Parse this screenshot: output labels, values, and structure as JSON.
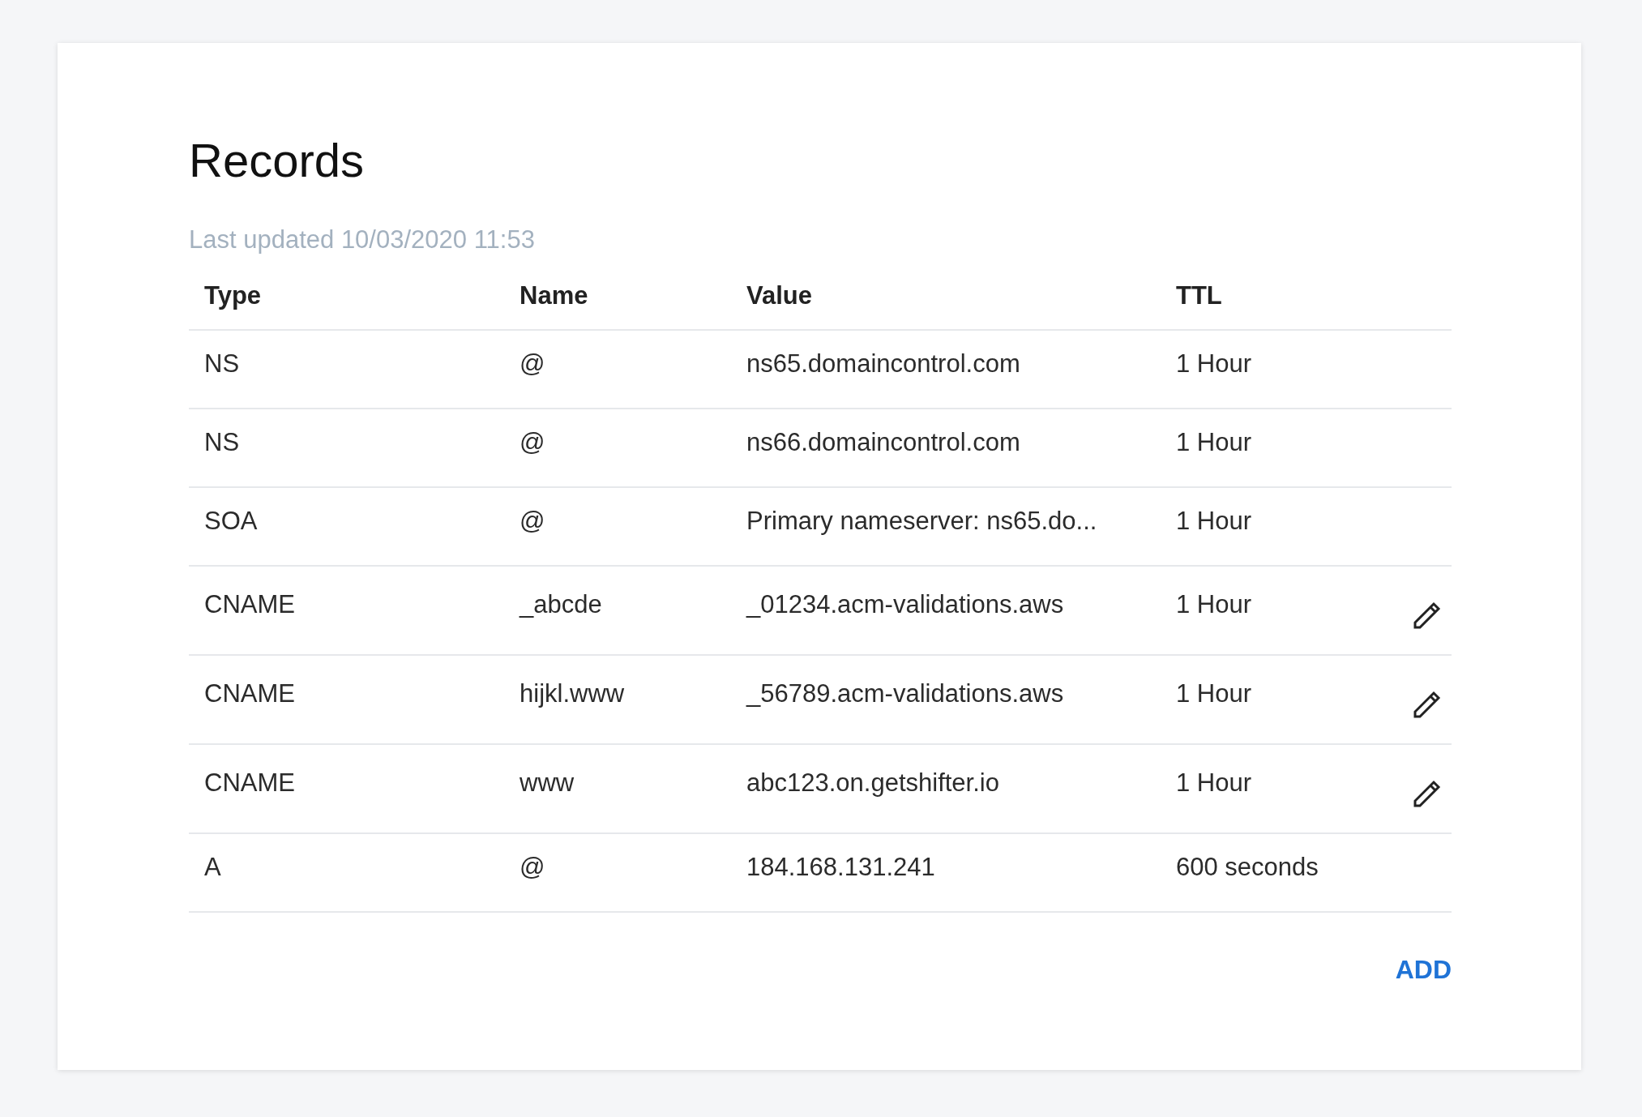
{
  "title": "Records",
  "last_updated": "Last updated 10/03/2020 11:53",
  "table": {
    "columns": [
      "Type",
      "Name",
      "Value",
      "TTL"
    ],
    "rows": [
      {
        "type": "NS",
        "name": "@",
        "value": "ns65.domaincontrol.com",
        "ttl": "1 Hour",
        "editable": false
      },
      {
        "type": "NS",
        "name": "@",
        "value": "ns66.domaincontrol.com",
        "ttl": "1 Hour",
        "editable": false
      },
      {
        "type": "SOA",
        "name": "@",
        "value": "Primary nameserver: ns65.do...",
        "ttl": "1 Hour",
        "editable": false
      },
      {
        "type": "CNAME",
        "name": "_abcde",
        "value": "_01234.acm-validations.aws",
        "ttl": "1 Hour",
        "editable": true
      },
      {
        "type": "CNAME",
        "name": "hijkl.www",
        "value": "_56789.acm-validations.aws",
        "ttl": "1 Hour",
        "editable": true
      },
      {
        "type": "CNAME",
        "name": "www",
        "value": "abc123.on.getshifter.io",
        "ttl": "1 Hour",
        "editable": true
      },
      {
        "type": "A",
        "name": "@",
        "value": "184.168.131.241",
        "ttl": "600 seconds",
        "editable": false
      }
    ]
  },
  "add_button": "ADD"
}
